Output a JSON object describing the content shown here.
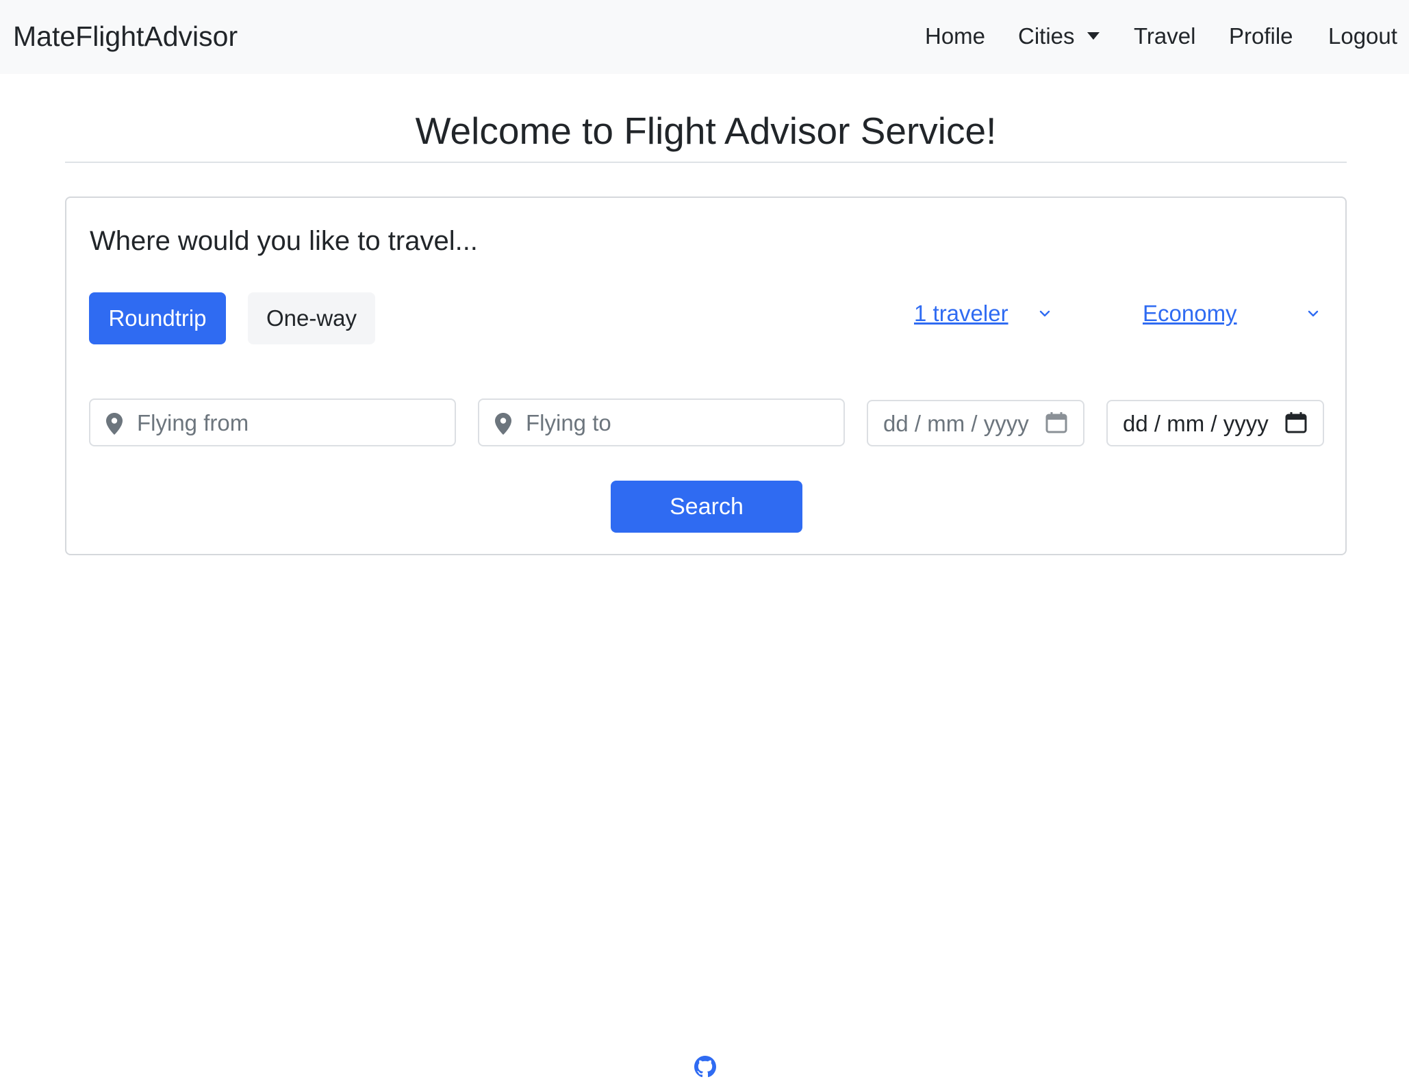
{
  "navbar": {
    "brand": "MateFlightAdvisor",
    "items": [
      {
        "label": "Home"
      },
      {
        "label": "Cities"
      },
      {
        "label": "Travel"
      },
      {
        "label": "Profile"
      },
      {
        "label": "Logout"
      }
    ]
  },
  "page": {
    "title": "Welcome to Flight Advisor Service!"
  },
  "search_card": {
    "heading": "Where would you like to travel...",
    "trip_types": [
      {
        "label": "Roundtrip",
        "selected": true
      },
      {
        "label": "One-way",
        "selected": false
      }
    ],
    "travelers": {
      "label": "1 traveler"
    },
    "cabin_class": {
      "label": "Economy"
    },
    "from": {
      "placeholder": "Flying from",
      "value": ""
    },
    "to": {
      "placeholder": "Flying to",
      "value": ""
    },
    "depart_date": {
      "text": "dd / mm / yyyy"
    },
    "return_date": {
      "text": "dd / mm / yyyy"
    },
    "search_label": "Search"
  },
  "footer": {
    "icon": "github-icon"
  },
  "colors": {
    "primary": "#2f6bf2",
    "navbar_bg": "#f8f9fa",
    "text": "#212529",
    "muted": "#6c757d"
  }
}
